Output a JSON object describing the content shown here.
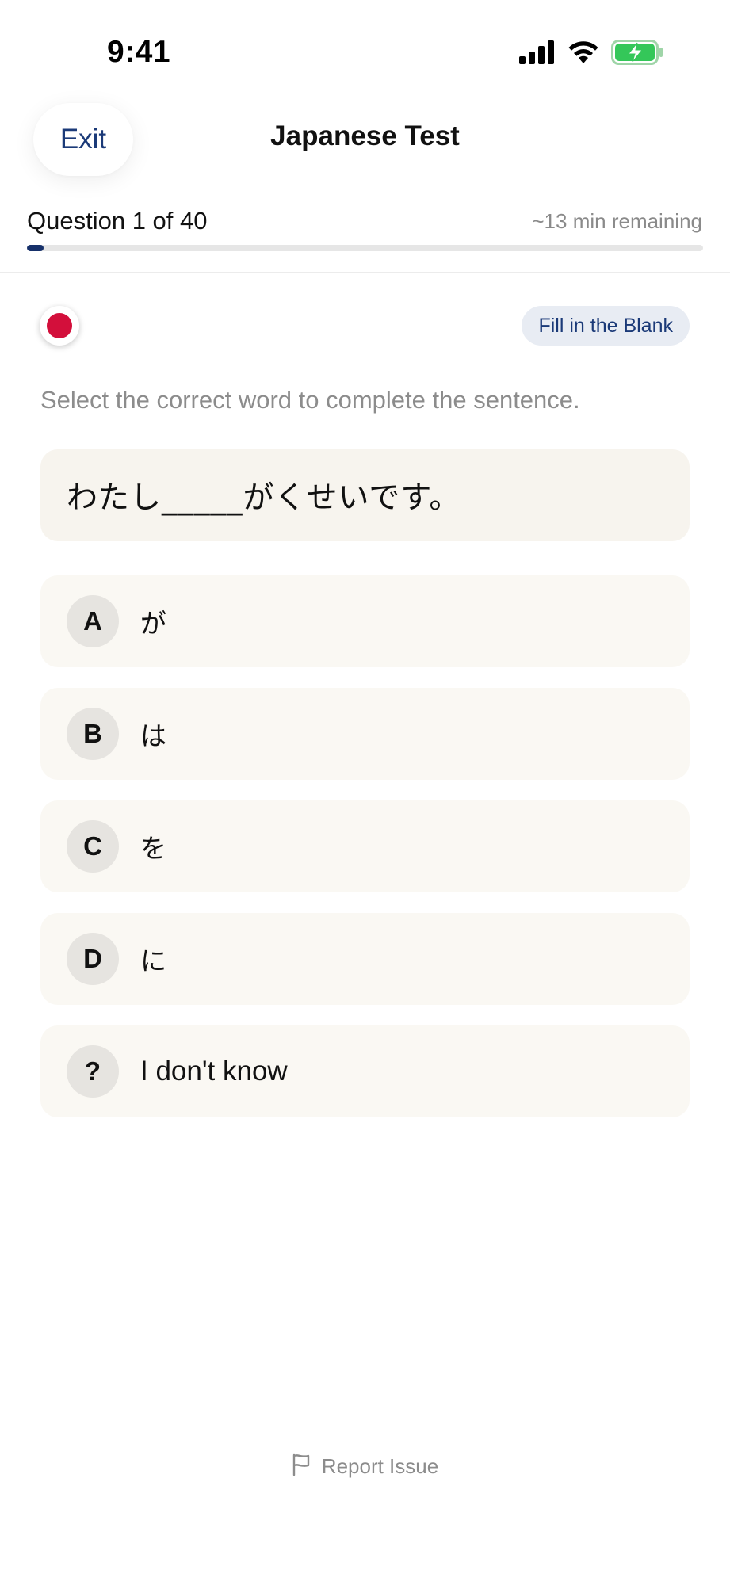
{
  "status_bar": {
    "time": "9:41",
    "icons": [
      "signal-icon",
      "wifi-icon",
      "battery-charging-icon"
    ]
  },
  "nav": {
    "exit_label": "Exit",
    "title": "Japanese Test"
  },
  "progress": {
    "question_label": "Question 1 of 40",
    "time_remaining": "~13 min remaining",
    "current": 1,
    "total": 40,
    "fraction": 0.025,
    "fill_color": "#16306a"
  },
  "question": {
    "flag_icon": "japan-flag-icon",
    "flag_color": "#d30f3b",
    "type_label": "Fill in the Blank",
    "instruction": "Select the correct word to complete the sentence.",
    "prompt": "わたし_____がくせいです。"
  },
  "options": [
    {
      "letter": "A",
      "text": "が"
    },
    {
      "letter": "B",
      "text": "は"
    },
    {
      "letter": "C",
      "text": "を"
    },
    {
      "letter": "D",
      "text": "に"
    },
    {
      "letter": "?",
      "text": "I don't know"
    }
  ],
  "footer": {
    "report_label": "Report Issue",
    "report_icon": "flag-outline-icon"
  },
  "colors": {
    "accent": "#1b3a78",
    "card_background": "#f7f4ee",
    "option_background": "#faf8f3",
    "muted_text": "#8c8c8c"
  }
}
